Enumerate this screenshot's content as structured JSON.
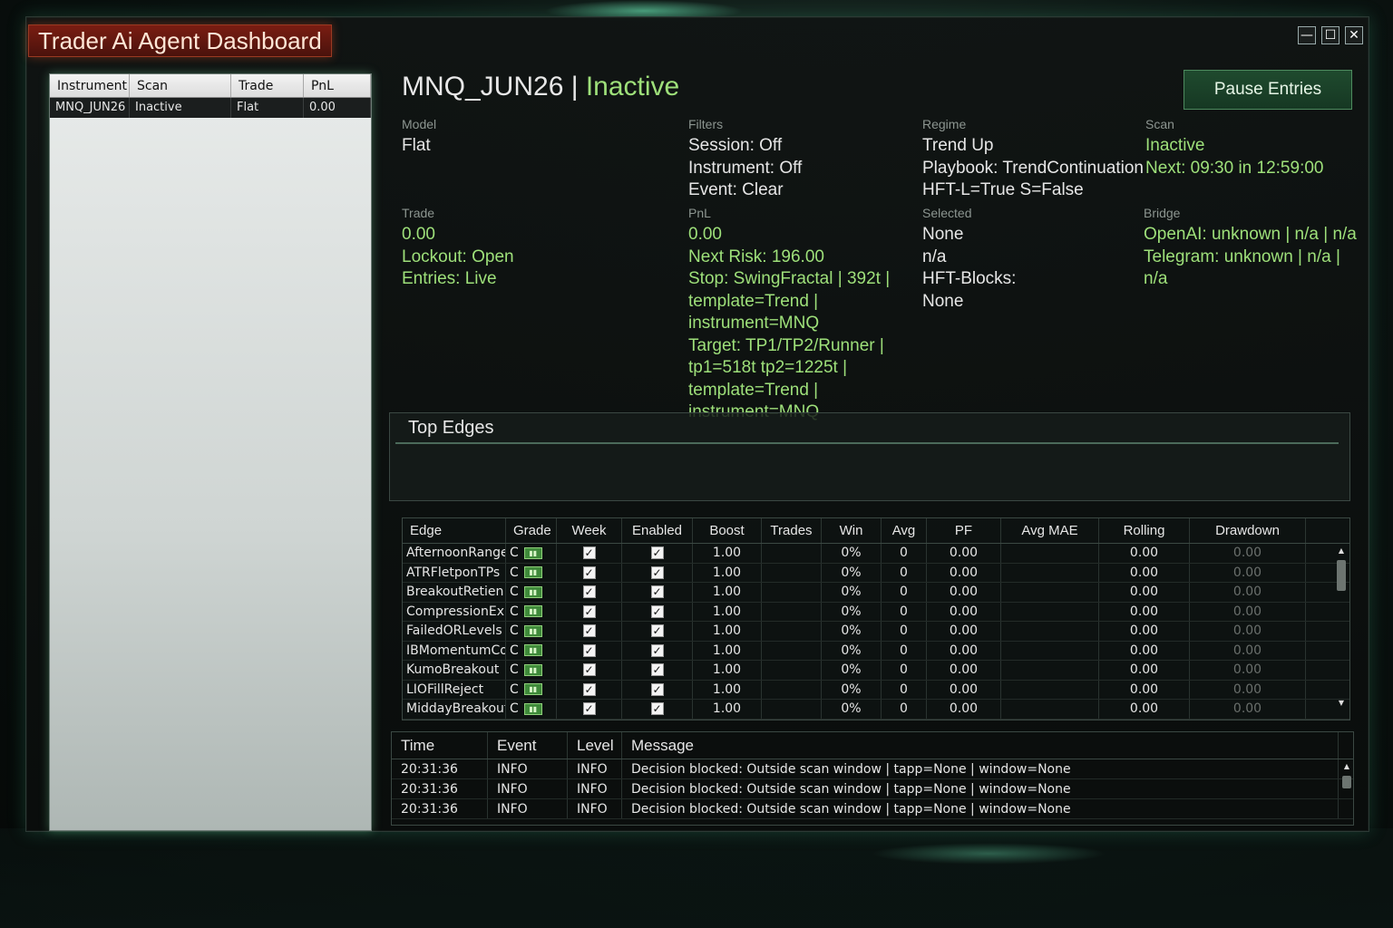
{
  "window": {
    "title": "Trader Ai Agent Dashboard",
    "controls": {
      "minimize": "—",
      "maximize": "☐",
      "close": "✕"
    }
  },
  "instruments": {
    "columns": [
      "Instrument",
      "Scan",
      "Trade",
      "PnL"
    ],
    "rows": [
      {
        "instrument": "MNQ_JUN26",
        "scan": "Inactive",
        "trade": "Flat",
        "pnl": "0.00"
      }
    ]
  },
  "header": {
    "symbol": "MNQ_JUN26",
    "separator": " | ",
    "status": "Inactive",
    "pause_button": "Pause Entries"
  },
  "info": {
    "model": {
      "label": "Model",
      "value": "Flat"
    },
    "filters": {
      "label": "Filters",
      "session": "Session: Off",
      "instrument": "Instrument: Off",
      "event": "Event: Clear"
    },
    "regime": {
      "label": "Regime",
      "trend": "Trend Up",
      "playbook": "Playbook: TrendContinuation",
      "hft": "HFT-L=True S=False"
    },
    "scan": {
      "label": "Scan",
      "status": "Inactive",
      "next": "Next: 09:30 in 12:59:00"
    },
    "trade": {
      "label": "Trade",
      "value": "0.00",
      "lockout": "Lockout: Open",
      "entries": "Entries: Live"
    },
    "pnl": {
      "label": "PnL",
      "value": "0.00",
      "next_risk": "Next Risk: 196.00",
      "stop_target_lines": [
        "Stop: SwingFractal | 392t |",
        "template=Trend |",
        "instrument=MNQ",
        "Target: TP1/TP2/Runner |",
        "tp1=518t tp2=1225t |",
        "template=Trend |",
        "instrument=MNQ"
      ]
    },
    "selected": {
      "label": "Selected",
      "value": "None",
      "na": "n/a",
      "hft_blocks": "HFT-Blocks:",
      "hft_blocks_value": "None"
    },
    "bridge": {
      "label": "Bridge",
      "openai": "OpenAI: unknown | n/a | n/a",
      "telegram": "Telegram: unknown | n/a | n/a"
    }
  },
  "top_edges": {
    "title": "Top Edges"
  },
  "edges_table": {
    "columns": [
      "Edge",
      "Grade",
      "Week",
      "Enabled",
      "Boost",
      "Trades",
      "Win",
      "Avg",
      "PF",
      "Avg MAE",
      "Rolling",
      "Drawdown"
    ],
    "rows": [
      {
        "edge": "AfternoonRange",
        "grade": "C",
        "boost": "1.00",
        "win": "0%",
        "avg": "0",
        "pf": "0.00",
        "rolling": "0.00",
        "drawdown": "0.00"
      },
      {
        "edge": "ATRFletponTPs",
        "grade": "C",
        "boost": "1.00",
        "win": "0%",
        "avg": "0",
        "pf": "0.00",
        "rolling": "0.00",
        "drawdown": "0.00"
      },
      {
        "edge": "BreakoutRetien",
        "grade": "C",
        "boost": "1.00",
        "win": "0%",
        "avg": "0",
        "pf": "0.00",
        "rolling": "0.00",
        "drawdown": "0.00"
      },
      {
        "edge": "CompressionExpar",
        "grade": "C",
        "boost": "1.00",
        "win": "0%",
        "avg": "0",
        "pf": "0.00",
        "rolling": "0.00",
        "drawdown": "0.00"
      },
      {
        "edge": "FailedORLevels",
        "grade": "C",
        "boost": "1.00",
        "win": "0%",
        "avg": "0",
        "pf": "0.00",
        "rolling": "0.00",
        "drawdown": "0.00"
      },
      {
        "edge": "IBMomentumCon",
        "grade": "C",
        "boost": "1.00",
        "win": "0%",
        "avg": "0",
        "pf": "0.00",
        "rolling": "0.00",
        "drawdown": "0.00"
      },
      {
        "edge": "KumoBreakout",
        "grade": "C",
        "boost": "1.00",
        "win": "0%",
        "avg": "0",
        "pf": "0.00",
        "rolling": "0.00",
        "drawdown": "0.00"
      },
      {
        "edge": "LIOFillReject",
        "grade": "C",
        "boost": "1.00",
        "win": "0%",
        "avg": "0",
        "pf": "0.00",
        "rolling": "0.00",
        "drawdown": "0.00"
      },
      {
        "edge": "MiddayBreakoutOR",
        "grade": "C",
        "boost": "1.00",
        "win": "0%",
        "avg": "0",
        "pf": "0.00",
        "rolling": "0.00",
        "drawdown": "0.00"
      }
    ]
  },
  "log": {
    "columns": [
      "Time",
      "Event",
      "Level",
      "Message"
    ],
    "rows": [
      {
        "time": "20:31:36",
        "event": "INFO",
        "level": "INFO",
        "message": "Decision blocked: Outside scan window | tapp=None | window=None"
      },
      {
        "time": "20:31:36",
        "event": "INFO",
        "level": "INFO",
        "message": "Decision blocked: Outside scan window | tapp=None | window=None"
      },
      {
        "time": "20:31:36",
        "event": "INFO",
        "level": "INFO",
        "message": "Decision blocked: Outside scan window | tapp=None | window=None"
      }
    ]
  },
  "colors": {
    "accent_green": "#9ee07a",
    "title_red": "#7a1d12",
    "button_green": "#1f4a2e"
  }
}
